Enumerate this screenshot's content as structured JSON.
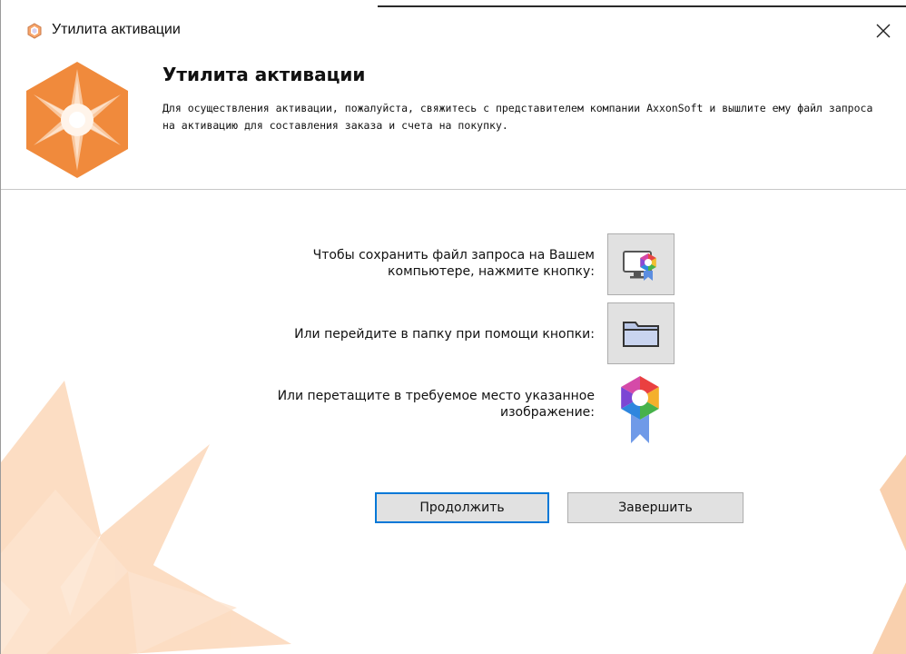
{
  "window": {
    "title": "Утилита активации",
    "icons": {
      "app": "app-logo-icon",
      "close": "close-icon"
    }
  },
  "header": {
    "title": "Утилита активации",
    "description": "Для осуществления активации, пожалуйста, свяжитесь с представителем компании AxxonSoft и вышлите ему файл запроса на активацию для составления заказа и счета на покупку.",
    "logo": "axxon-star-logo-icon"
  },
  "actions": {
    "save_label_line1": "Чтобы сохранить файл запроса на Вашем",
    "save_label_line2": "компьютере, нажмите кнопку:",
    "save_icon": "save-request-computer-icon",
    "folder_label": "Или перейдите в папку при помощи кнопки:",
    "folder_icon": "folder-icon",
    "drag_label_line1": "Или перетащите в требуемое место указанное",
    "drag_label_line2": "изображение:",
    "drag_icon": "activation-badge-icon"
  },
  "buttons": {
    "continue": "Продолжить",
    "finish": "Завершить"
  },
  "colors": {
    "accent_orange": "#f08a3c",
    "focus_blue": "#0078d7",
    "button_bg": "#e1e1e1"
  }
}
